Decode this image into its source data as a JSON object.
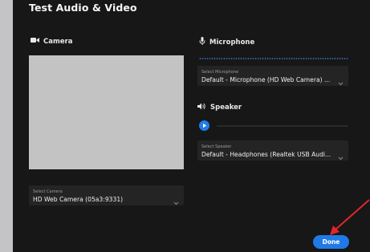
{
  "dialog": {
    "title": "Test Audio & Video",
    "done_label": "Done"
  },
  "camera": {
    "section_label": "Camera",
    "icon": "video-camera-icon",
    "select_caption": "Select Camera",
    "select_value": "HD Web Camera (05a3:9331)"
  },
  "microphone": {
    "section_label": "Microphone",
    "icon": "microphone-icon",
    "select_caption": "Select Microphone",
    "select_value": "Default - Microphone (HD Web Camera) ..."
  },
  "speaker": {
    "section_label": "Speaker",
    "icon": "speaker-icon",
    "select_caption": "Select Speaker",
    "select_value": "Default - Headphones (Realtek USB Audi..."
  },
  "colors": {
    "accent": "#1f7ae6",
    "background": "#171717",
    "annotation_arrow": "#e0262b"
  }
}
